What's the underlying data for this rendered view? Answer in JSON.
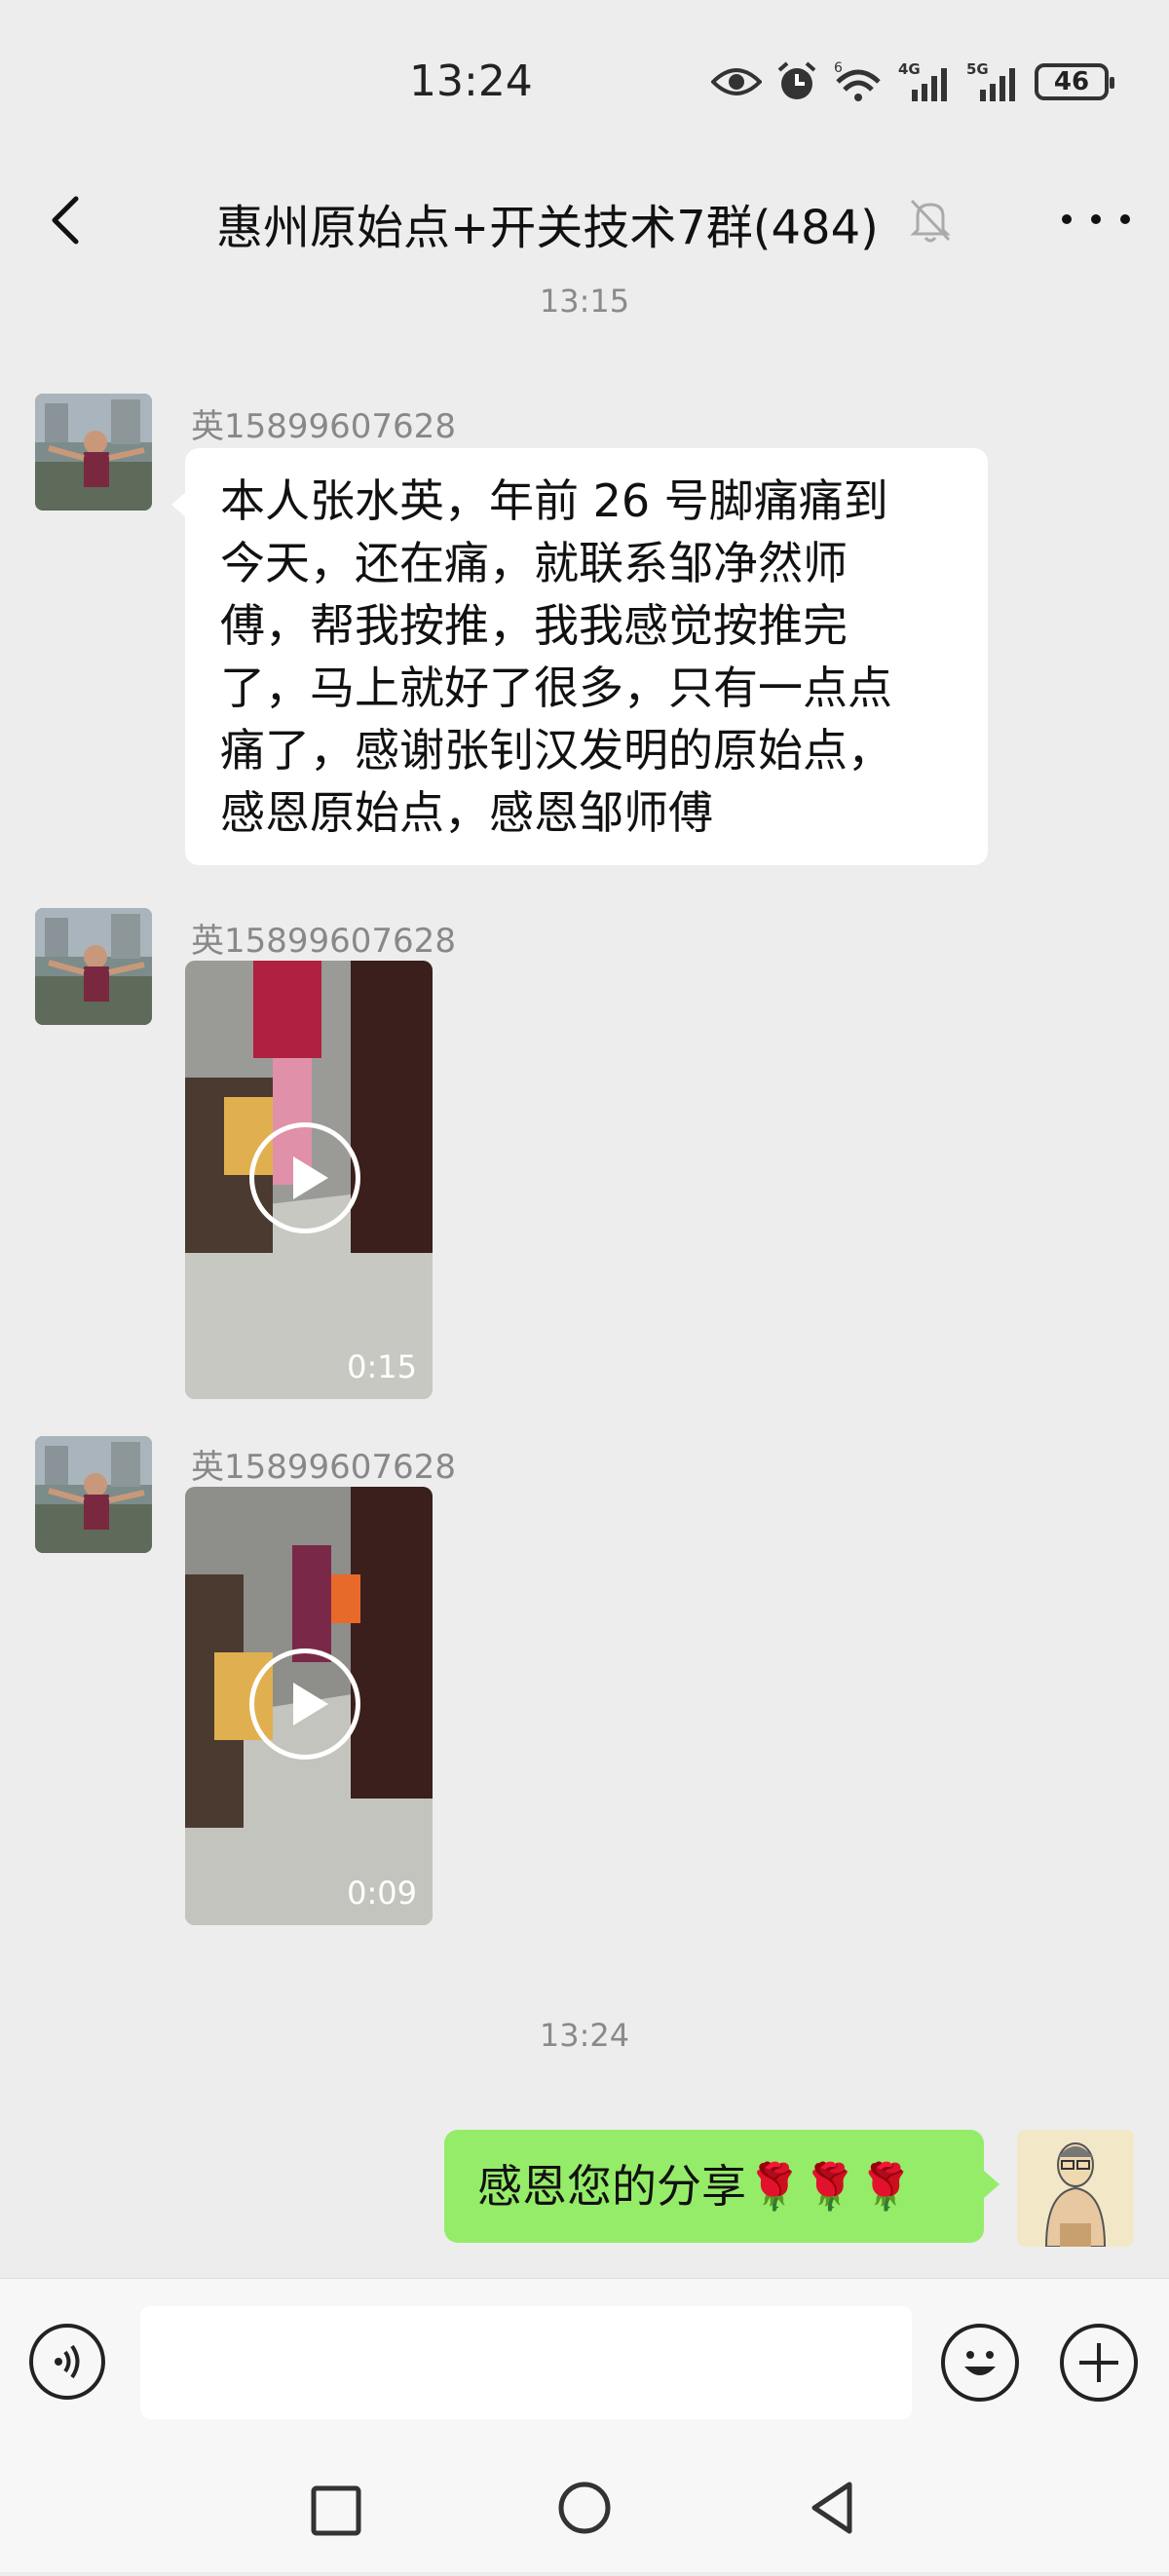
{
  "status_bar": {
    "time": "13:24",
    "battery": "46",
    "icons": [
      "eye-icon",
      "alarm-icon",
      "wifi-6-icon",
      "signal-4g-icon",
      "signal-5g-icon",
      "battery-icon"
    ]
  },
  "header": {
    "title": "惠州原始点+开关技术7群(484)",
    "icons": [
      "back-icon",
      "mute-bell-icon",
      "more-icon"
    ]
  },
  "messages": [
    {
      "type": "timestamp",
      "text": "13:15"
    },
    {
      "type": "text",
      "sender": "英15899607628",
      "lines": [
        "本人张水英，年前 26 号脚痛痛到",
        "今天，还在痛，就联系邹净然师",
        "傅，帮我按推，我我感觉按推完",
        "了，马上就好了很多，只有一点点",
        "痛了，感谢张钊汉发明的原始点，",
        "感恩原始点，感恩邹师傅"
      ]
    },
    {
      "type": "video",
      "sender": "英15899607628",
      "duration": "0:15"
    },
    {
      "type": "video",
      "sender": "英15899607628",
      "duration": "0:09"
    },
    {
      "type": "timestamp",
      "text": "13:24"
    },
    {
      "type": "text-self",
      "text": "感恩您的分享🌹🌹🌹"
    }
  ],
  "input_bar": {
    "value": "",
    "icons": [
      "voice-icon",
      "emoji-icon",
      "plus-icon"
    ]
  },
  "nav_bar": {
    "icons": [
      "recent-apps-icon",
      "home-icon",
      "back-nav-icon"
    ]
  },
  "colors": {
    "background": "#ededed",
    "self_bubble": "#95ec69",
    "other_bubble": "#ffffff"
  }
}
